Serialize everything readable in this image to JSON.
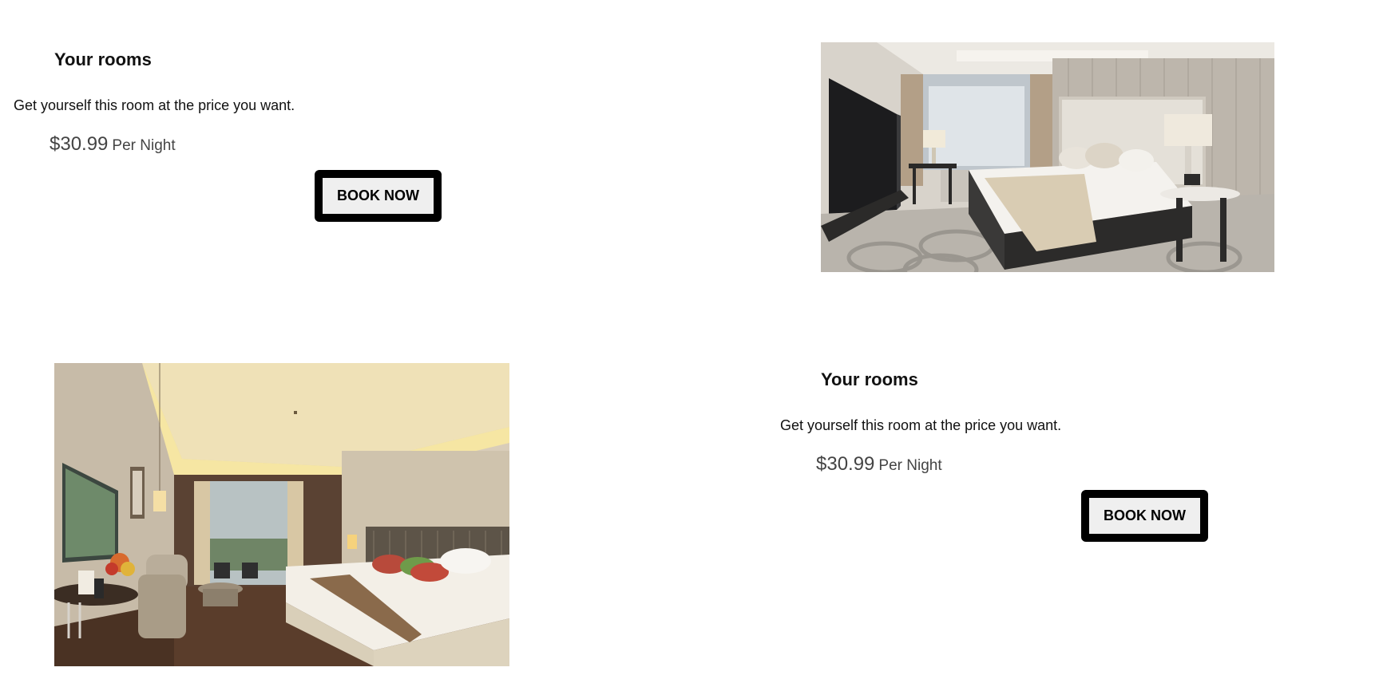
{
  "rooms": [
    {
      "title": "Your rooms",
      "subtitle": "Get yourself this room at the price you want.",
      "price": "$30.99",
      "price_unit": "Per Night",
      "button_label": "BOOK NOW",
      "image": "hotel-room-photo"
    },
    {
      "title": "Your rooms",
      "subtitle": "Get yourself this room at the price you want.",
      "price": "$30.99",
      "price_unit": "Per Night",
      "button_label": "BOOK NOW",
      "image": "hotel-room-photo"
    }
  ]
}
